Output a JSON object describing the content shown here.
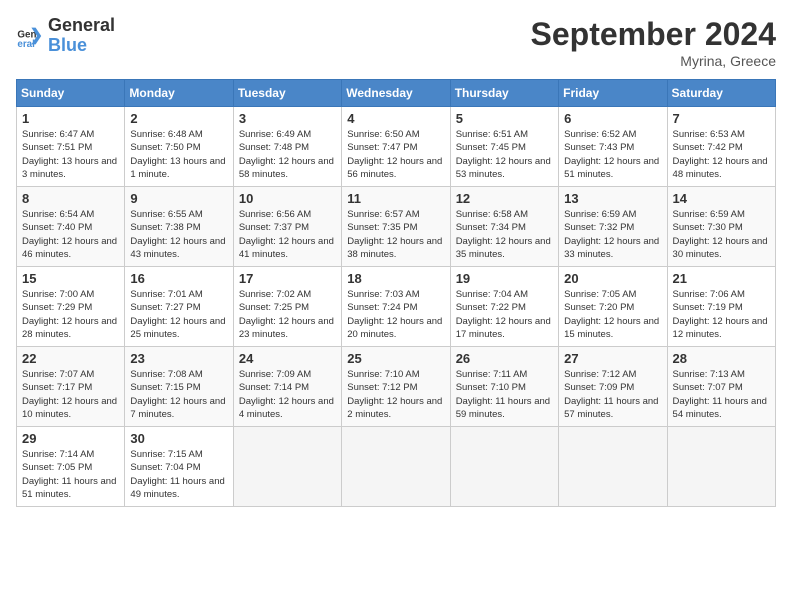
{
  "header": {
    "logo_line1": "General",
    "logo_line2": "Blue",
    "month": "September 2024",
    "location": "Myrina, Greece"
  },
  "weekdays": [
    "Sunday",
    "Monday",
    "Tuesday",
    "Wednesday",
    "Thursday",
    "Friday",
    "Saturday"
  ],
  "weeks": [
    [
      {
        "day": "1",
        "sunrise": "6:47 AM",
        "sunset": "7:51 PM",
        "daylight": "13 hours and 3 minutes."
      },
      {
        "day": "2",
        "sunrise": "6:48 AM",
        "sunset": "7:50 PM",
        "daylight": "13 hours and 1 minute."
      },
      {
        "day": "3",
        "sunrise": "6:49 AM",
        "sunset": "7:48 PM",
        "daylight": "12 hours and 58 minutes."
      },
      {
        "day": "4",
        "sunrise": "6:50 AM",
        "sunset": "7:47 PM",
        "daylight": "12 hours and 56 minutes."
      },
      {
        "day": "5",
        "sunrise": "6:51 AM",
        "sunset": "7:45 PM",
        "daylight": "12 hours and 53 minutes."
      },
      {
        "day": "6",
        "sunrise": "6:52 AM",
        "sunset": "7:43 PM",
        "daylight": "12 hours and 51 minutes."
      },
      {
        "day": "7",
        "sunrise": "6:53 AM",
        "sunset": "7:42 PM",
        "daylight": "12 hours and 48 minutes."
      }
    ],
    [
      {
        "day": "8",
        "sunrise": "6:54 AM",
        "sunset": "7:40 PM",
        "daylight": "12 hours and 46 minutes."
      },
      {
        "day": "9",
        "sunrise": "6:55 AM",
        "sunset": "7:38 PM",
        "daylight": "12 hours and 43 minutes."
      },
      {
        "day": "10",
        "sunrise": "6:56 AM",
        "sunset": "7:37 PM",
        "daylight": "12 hours and 41 minutes."
      },
      {
        "day": "11",
        "sunrise": "6:57 AM",
        "sunset": "7:35 PM",
        "daylight": "12 hours and 38 minutes."
      },
      {
        "day": "12",
        "sunrise": "6:58 AM",
        "sunset": "7:34 PM",
        "daylight": "12 hours and 35 minutes."
      },
      {
        "day": "13",
        "sunrise": "6:59 AM",
        "sunset": "7:32 PM",
        "daylight": "12 hours and 33 minutes."
      },
      {
        "day": "14",
        "sunrise": "6:59 AM",
        "sunset": "7:30 PM",
        "daylight": "12 hours and 30 minutes."
      }
    ],
    [
      {
        "day": "15",
        "sunrise": "7:00 AM",
        "sunset": "7:29 PM",
        "daylight": "12 hours and 28 minutes."
      },
      {
        "day": "16",
        "sunrise": "7:01 AM",
        "sunset": "7:27 PM",
        "daylight": "12 hours and 25 minutes."
      },
      {
        "day": "17",
        "sunrise": "7:02 AM",
        "sunset": "7:25 PM",
        "daylight": "12 hours and 23 minutes."
      },
      {
        "day": "18",
        "sunrise": "7:03 AM",
        "sunset": "7:24 PM",
        "daylight": "12 hours and 20 minutes."
      },
      {
        "day": "19",
        "sunrise": "7:04 AM",
        "sunset": "7:22 PM",
        "daylight": "12 hours and 17 minutes."
      },
      {
        "day": "20",
        "sunrise": "7:05 AM",
        "sunset": "7:20 PM",
        "daylight": "12 hours and 15 minutes."
      },
      {
        "day": "21",
        "sunrise": "7:06 AM",
        "sunset": "7:19 PM",
        "daylight": "12 hours and 12 minutes."
      }
    ],
    [
      {
        "day": "22",
        "sunrise": "7:07 AM",
        "sunset": "7:17 PM",
        "daylight": "12 hours and 10 minutes."
      },
      {
        "day": "23",
        "sunrise": "7:08 AM",
        "sunset": "7:15 PM",
        "daylight": "12 hours and 7 minutes."
      },
      {
        "day": "24",
        "sunrise": "7:09 AM",
        "sunset": "7:14 PM",
        "daylight": "12 hours and 4 minutes."
      },
      {
        "day": "25",
        "sunrise": "7:10 AM",
        "sunset": "7:12 PM",
        "daylight": "12 hours and 2 minutes."
      },
      {
        "day": "26",
        "sunrise": "7:11 AM",
        "sunset": "7:10 PM",
        "daylight": "11 hours and 59 minutes."
      },
      {
        "day": "27",
        "sunrise": "7:12 AM",
        "sunset": "7:09 PM",
        "daylight": "11 hours and 57 minutes."
      },
      {
        "day": "28",
        "sunrise": "7:13 AM",
        "sunset": "7:07 PM",
        "daylight": "11 hours and 54 minutes."
      }
    ],
    [
      {
        "day": "29",
        "sunrise": "7:14 AM",
        "sunset": "7:05 PM",
        "daylight": "11 hours and 51 minutes."
      },
      {
        "day": "30",
        "sunrise": "7:15 AM",
        "sunset": "7:04 PM",
        "daylight": "11 hours and 49 minutes."
      },
      null,
      null,
      null,
      null,
      null
    ]
  ]
}
